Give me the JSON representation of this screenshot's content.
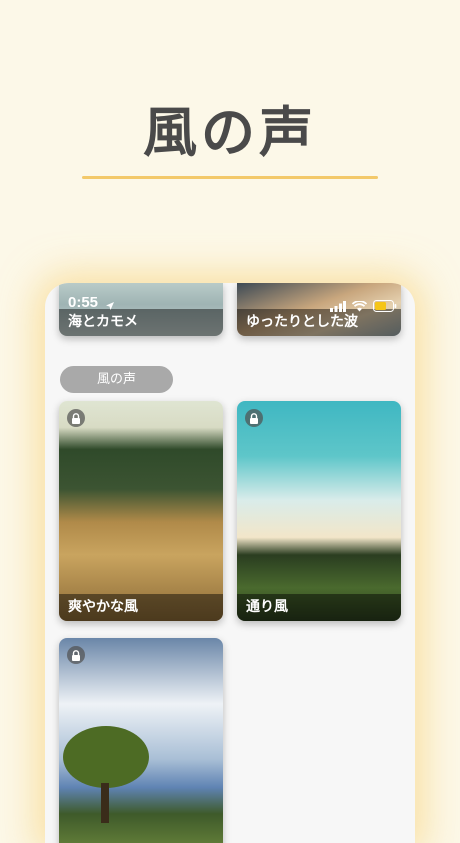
{
  "header": {
    "title": "風の声"
  },
  "status_bar": {
    "time": "0:55"
  },
  "top_tiles": [
    {
      "label": "海とカモメ"
    },
    {
      "label": "ゆったりとした波"
    }
  ],
  "section": {
    "label": "風の声"
  },
  "tiles": [
    {
      "label": "爽やかな風",
      "locked": true
    },
    {
      "label": "通り風",
      "locked": true
    },
    {
      "label": "",
      "locked": true
    }
  ],
  "colors": {
    "background": "#fcf8e8",
    "accent": "#f3c96a",
    "title": "#4a4a4a"
  }
}
